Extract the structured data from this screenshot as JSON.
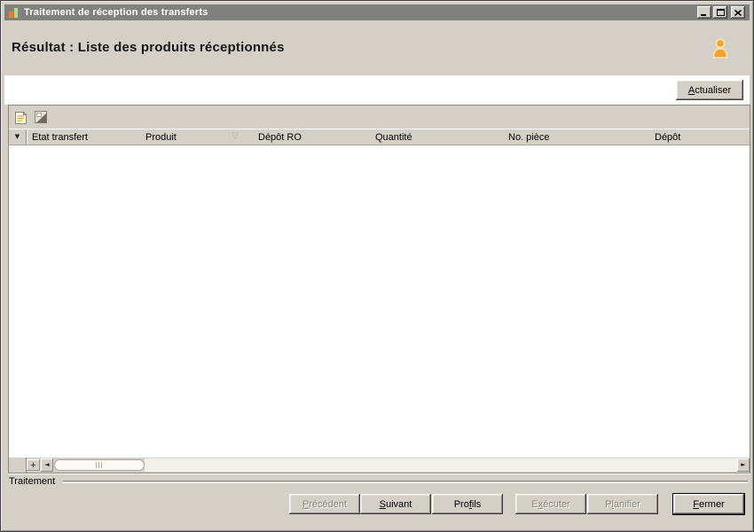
{
  "window": {
    "title": "Traitement de réception des transferts"
  },
  "header": {
    "title": "Résultat : Liste des produits réceptionnés"
  },
  "toolbar": {
    "actualiser": {
      "label": "Actualiser",
      "pre": "",
      "key": "A",
      "post": "ctualiser"
    }
  },
  "grid": {
    "selector_glyph": "▼",
    "sort_glyph": "▽",
    "columns": [
      {
        "label": "Etat transfert"
      },
      {
        "label": "Produit",
        "sorted": true
      },
      {
        "label": "Dépôt RO"
      },
      {
        "label": "Quantité"
      },
      {
        "label": "No. pièce"
      },
      {
        "label": "Dépôt"
      }
    ],
    "rows": [],
    "add_row_label": "+",
    "scroll_left_glyph": "◄",
    "scroll_right_glyph": "►"
  },
  "status": {
    "group_label": "Traitement"
  },
  "footer": {
    "buttons": [
      {
        "label": "Précédent",
        "pre": "",
        "key": "P",
        "post": "récédent",
        "disabled": true
      },
      {
        "label": "Suivant",
        "pre": "",
        "key": "S",
        "post": "uivant",
        "disabled": false
      },
      {
        "label": "Profils",
        "pre": "Pro",
        "key": "f",
        "post": "ils",
        "disabled": false
      },
      {
        "label": "Exécuter",
        "pre": "E",
        "key": "x",
        "post": "écuter",
        "disabled": true
      },
      {
        "label": "Planifier",
        "pre": "P",
        "key": "l",
        "post": "anifier",
        "disabled": true
      },
      {
        "label": "Fermer",
        "pre": "",
        "key": "F",
        "post": "ermer",
        "disabled": false,
        "default": true
      }
    ]
  },
  "colors": {
    "titlebar": "#80807d",
    "dialog_background": "#d4d0c8",
    "content_background": "#ffffff",
    "accent_orange": "#f0a233",
    "icon_green": "#b2dc86",
    "icon_orange": "#e87c3a",
    "disabled_text": "#87837b"
  }
}
